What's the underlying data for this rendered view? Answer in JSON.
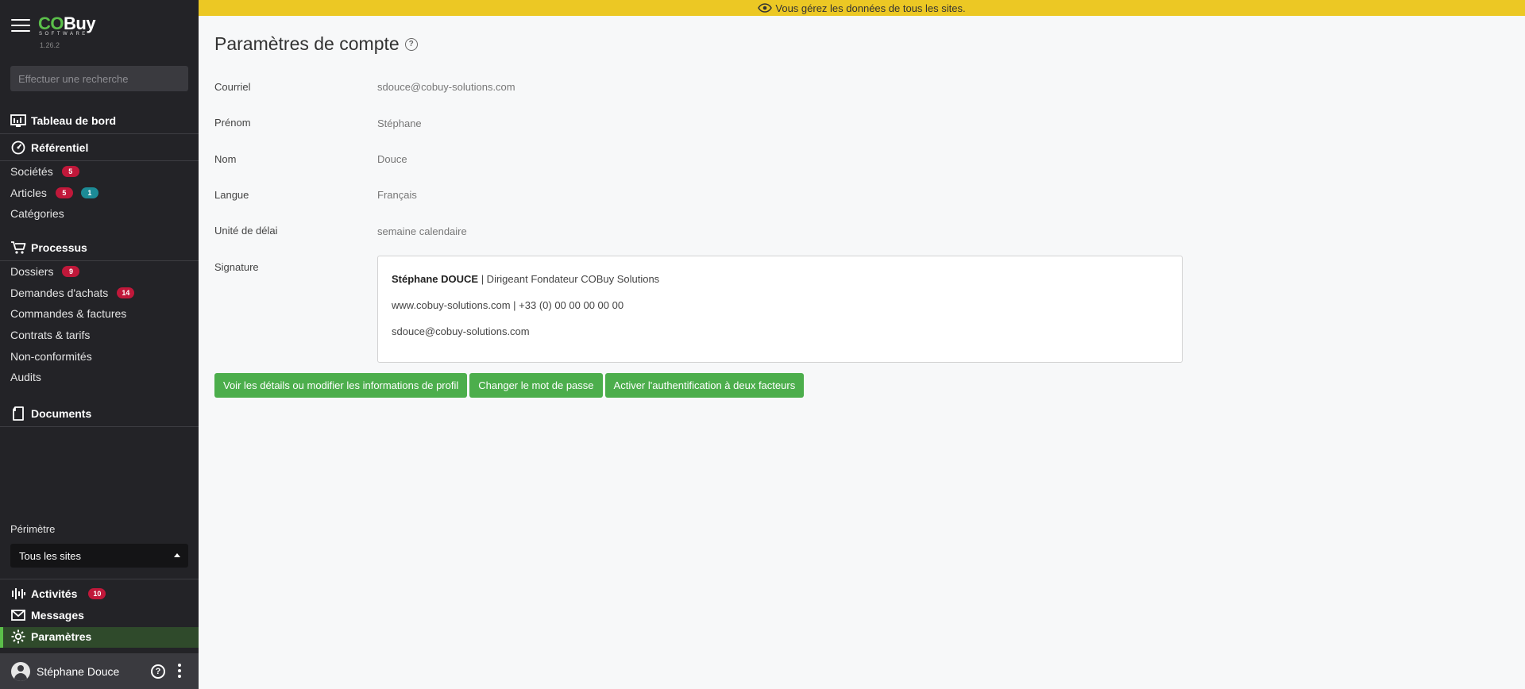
{
  "sidebar": {
    "brand": {
      "co": "CO",
      "buy": "Buy",
      "software": "SOFTWARE",
      "version": "1.26.2"
    },
    "search_placeholder": "Effectuer une recherche",
    "dashboard": "Tableau de bord",
    "referentiel": {
      "label": "Référentiel",
      "items": [
        {
          "label": "Sociétés",
          "badge": "5",
          "badge_color": "#c0183a"
        },
        {
          "label": "Articles",
          "badge": "5",
          "badge_color": "#c0183a",
          "badge2": "1",
          "badge2_color": "#1c8b96"
        },
        {
          "label": "Catégories"
        }
      ]
    },
    "processus": {
      "label": "Processus",
      "items": [
        {
          "label": "Dossiers",
          "badge": "9"
        },
        {
          "label": "Demandes d'achats",
          "badge": "14"
        },
        {
          "label": "Commandes & factures"
        },
        {
          "label": "Contrats & tarifs"
        },
        {
          "label": "Non-conformités"
        },
        {
          "label": "Audits"
        }
      ]
    },
    "documents": "Documents",
    "perimetre_label": "Périmètre",
    "perimetre_value": "Tous les sites",
    "activites": {
      "label": "Activités",
      "badge": "10"
    },
    "messages": "Messages",
    "parametres": "Paramètres",
    "user": {
      "name": "Stéphane Douce"
    }
  },
  "banner": {
    "text": "Vous gérez les données de tous les sites."
  },
  "main": {
    "title": "Paramètres de compte",
    "fields": [
      {
        "label": "Courriel",
        "value": "sdouce@cobuy-solutions.com"
      },
      {
        "label": "Prénom",
        "value": "Stéphane"
      },
      {
        "label": "Nom",
        "value": "Douce"
      },
      {
        "label": "Langue",
        "value": "Français"
      },
      {
        "label": "Unité de délai",
        "value": "semaine calendaire"
      }
    ],
    "signature": {
      "label": "Signature",
      "name": "Stéphane DOUCE",
      "role": " | Dirigeant Fondateur COBuy Solutions",
      "line2": "www.cobuy-solutions.com |  +33 (0) 00 00 00 00 00",
      "line3": "sdouce@cobuy-solutions.com"
    },
    "buttons": {
      "profile": "Voir les détails ou modifier les informations de profil",
      "password": "Changer le mot de passe",
      "two_factor": "Activer l'authentification à deux facteurs"
    }
  },
  "colors": {
    "accent_green": "#5bbf4a",
    "button_green": "#4cae4c",
    "banner_yellow": "#ecc824",
    "sidebar_bg": "#232327",
    "badge_red": "#c0183a",
    "badge_teal": "#1c8b96"
  }
}
